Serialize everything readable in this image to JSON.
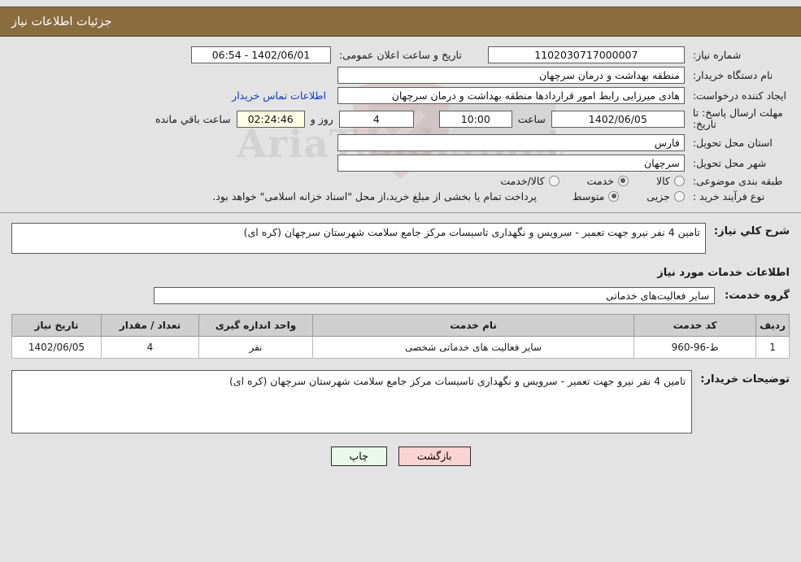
{
  "header": {
    "title": "جزئیات اطلاعات نیاز",
    "bar_color": "#8a6d3f"
  },
  "watermark": {
    "text": "AriaTender.net"
  },
  "need_info": {
    "need_number_label": "شماره نیاز:",
    "need_number_value": "1102030717000007",
    "announce_label": "تاریخ و ساعت اعلان عمومی:",
    "announce_value": "1402/06/01 - 06:54",
    "buyer_org_label": "نام دستگاه خریدار:",
    "buyer_org_value": "منطقه بهداشت و درمان سرچهان",
    "creator_label": "ایجاد کننده درخواست:",
    "creator_value": "هادی میرزایی رابط امور قراردادها منطقه بهداشت و درمان سرچهان",
    "contact_link": "اطلاعات تماس خریدار",
    "deadline_label": "مهلت ارسال پاسخ: تا تاریخ:",
    "deadline_date": "1402/06/05",
    "deadline_hour_label": "ساعت",
    "deadline_hour": "10:00",
    "days_value": "4",
    "days_sep": "روز و",
    "remaining_time": "02:24:46",
    "remaining_label": "ساعت باقي مانده",
    "province_label": "استان محل تحویل:",
    "province_value": "فارس",
    "city_label": "شهر محل تحویل:",
    "city_value": "سرچهان",
    "category_label": "طبقه بندی موضوعی:",
    "category_options": [
      {
        "label": "کالا",
        "selected": false
      },
      {
        "label": "خدمت",
        "selected": true
      },
      {
        "label": "کالا/خدمت",
        "selected": false
      }
    ],
    "process_label": "نوع فرآیند خرید :",
    "process_options": [
      {
        "label": "جزیی",
        "selected": false
      },
      {
        "label": "متوسط",
        "selected": true
      }
    ],
    "process_note": "پرداخت تمام یا بخشی از مبلغ خرید،از محل \"اسناد خزانه اسلامی\" خواهد بود."
  },
  "summary": {
    "label": "شرح کلي نیاز:",
    "value": "تامین 4 نفر نیرو جهت تعمیر - سرویس و نگهداری تاسیسات مرکز جامع سلامت شهرستان سرچهان (کره ای)"
  },
  "services": {
    "section_title": "اطلاعات خدمات مورد نیاز",
    "group_label": "گروه خدمت:",
    "group_value": "سایر فعالیت‌های خدماتی",
    "columns": [
      "ردیف",
      "کد خدمت",
      "نام خدمت",
      "واحد اندازه گیری",
      "تعداد / مقدار",
      "تاریخ نیاز"
    ],
    "rows": [
      {
        "index": "1",
        "code": "ط-96-960",
        "name": "سایر فعالیت های خدماتی شخصی",
        "unit": "نفر",
        "quantity": "4",
        "need_date": "1402/06/05"
      }
    ]
  },
  "buyer_notes": {
    "label": "توضیحات خریدار:",
    "value": "تامین 4 نفر نیرو جهت تعمیر - سرویس و نگهداری تاسیسات مرکز جامع سلامت شهرستان سرچهان (کره ای)"
  },
  "footer": {
    "print_label": "چاپ",
    "back_label": "بازگشت"
  }
}
